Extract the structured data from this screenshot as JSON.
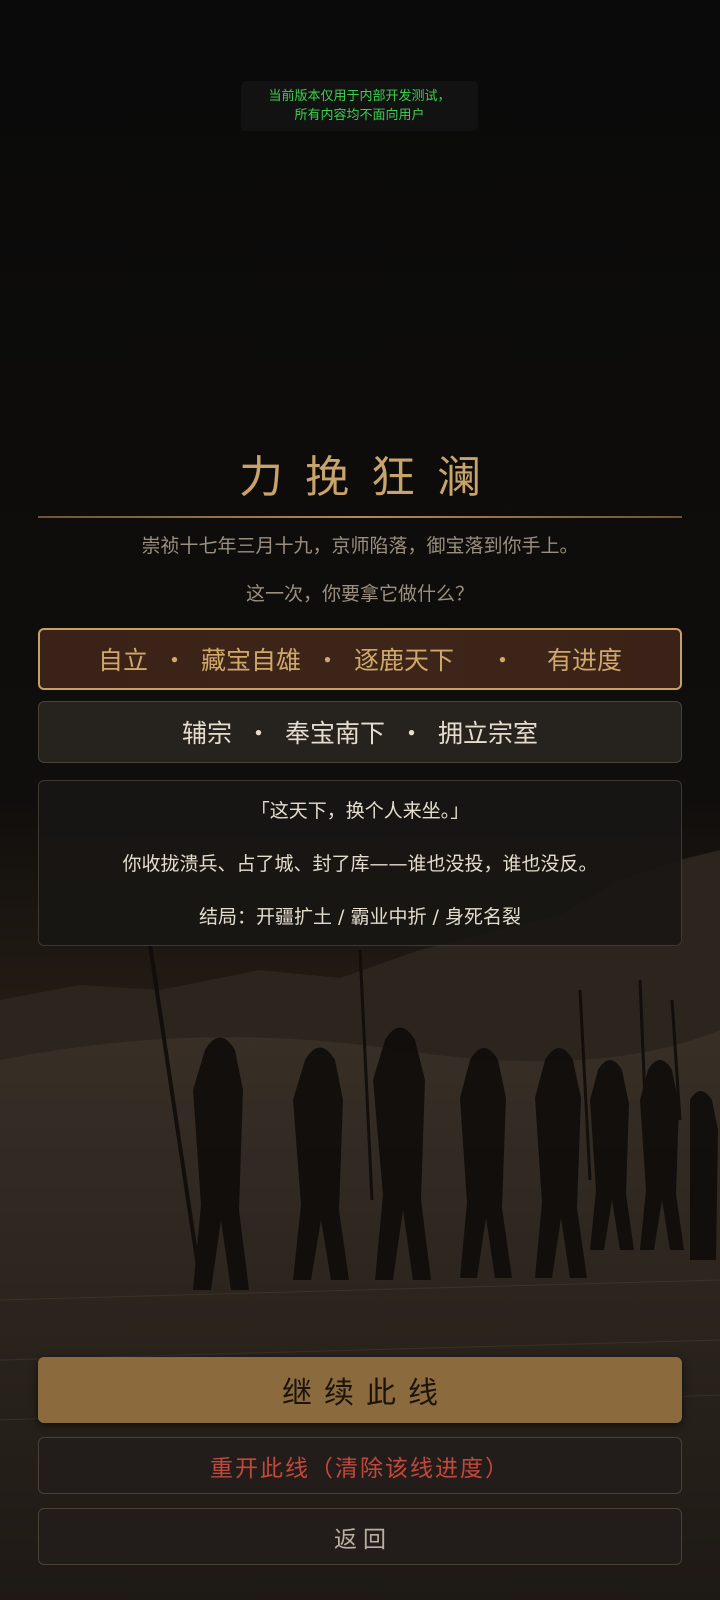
{
  "notice": {
    "line1": "当前版本仅用于内部开发测试，",
    "line2": "所有内容均不面向用户",
    "color": "#3ecf4f"
  },
  "title": "力挽狂澜",
  "subtitle": "崇祯十七年三月十九，京师陷落，御宝落到你手上。",
  "question": "这一次，你要拿它做什么？",
  "routes": [
    {
      "parts": [
        "自立",
        "藏宝自雄",
        "逐鹿天下"
      ],
      "separator": "・",
      "progress": "有进度",
      "selected": true
    },
    {
      "parts": [
        "辅宗",
        "奉宝南下",
        "拥立宗室"
      ],
      "separator": "・",
      "selected": false
    }
  ],
  "detail": {
    "quote": "「这天下，换个人来坐。」",
    "description": "你收拢溃兵、占了城、封了库——谁也没投，谁也没反。",
    "endings": "结局：开疆扩土 / 霸业中折 / 身死名裂"
  },
  "buttons": {
    "continue": "继续此线",
    "restart": "重开此线（清除该线进度）",
    "back": "返回"
  },
  "colors": {
    "gold": "#c9a46a",
    "continue_bg": "#8b6b3e",
    "restart_text": "#c2483b"
  },
  "background": {
    "scene": "army-silhouette-background"
  }
}
